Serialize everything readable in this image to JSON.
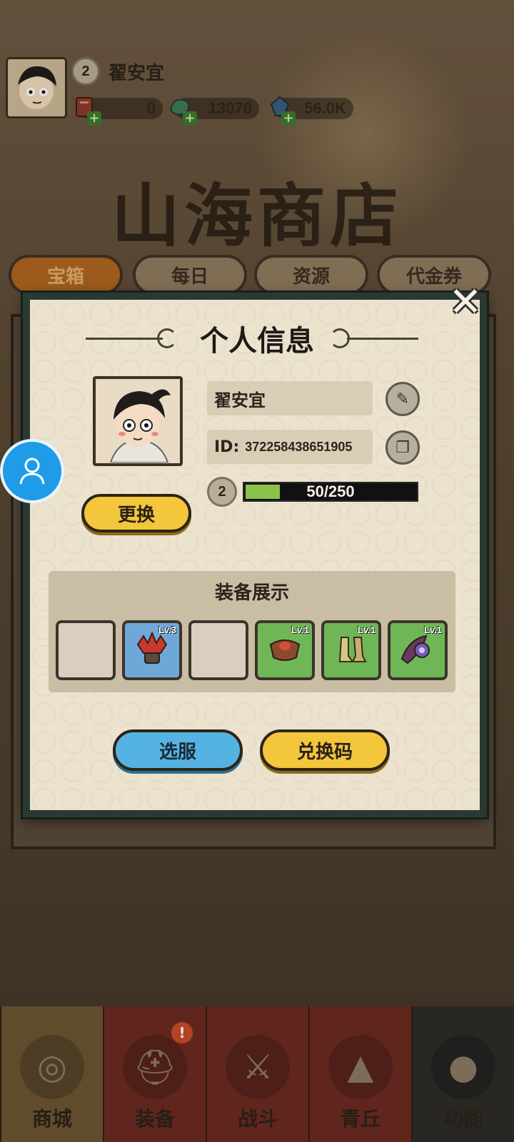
{
  "player": {
    "level": "2",
    "name": "翟安宜"
  },
  "resources": [
    {
      "icon": "red-ticket-icon",
      "value": "0"
    },
    {
      "icon": "jade-coin-icon",
      "value": "13070"
    },
    {
      "icon": "blue-gem-icon",
      "value": "56.0K"
    }
  ],
  "shop": {
    "title": "山海商店",
    "tabs": [
      "宝箱",
      "每日",
      "资源",
      "代金券"
    ],
    "active_tab": "宝箱"
  },
  "modal": {
    "title": "个人信息",
    "name": "翟安宜",
    "id_label": "ID:",
    "id_value": "372258438651905",
    "level": "2",
    "exp_text": "50/250",
    "exp_fraction": 0.2,
    "change_button": "更换",
    "equip_header": "装备展示",
    "equip_slots": [
      {
        "state": "empty",
        "lv": ""
      },
      {
        "state": "blue",
        "lv": "Lv.3",
        "icon": "red-helmet-icon"
      },
      {
        "state": "empty",
        "lv": ""
      },
      {
        "state": "green",
        "lv": "Lv.1",
        "icon": "armor-icon"
      },
      {
        "state": "green",
        "lv": "Lv.1",
        "icon": "boots-icon"
      },
      {
        "state": "green",
        "lv": "Lv.1",
        "icon": "amulet-icon"
      }
    ],
    "select_server_button": "选服",
    "redeem_code_button": "兑换码"
  },
  "bottom_nav": [
    "商城",
    "装备",
    "战斗",
    "青丘",
    "功能"
  ],
  "colors": {
    "yellow_button": "#f3c63c",
    "blue_button": "#55b3e3",
    "exp_fill": "#8ac24a",
    "modal_border": "#2a3a33"
  }
}
